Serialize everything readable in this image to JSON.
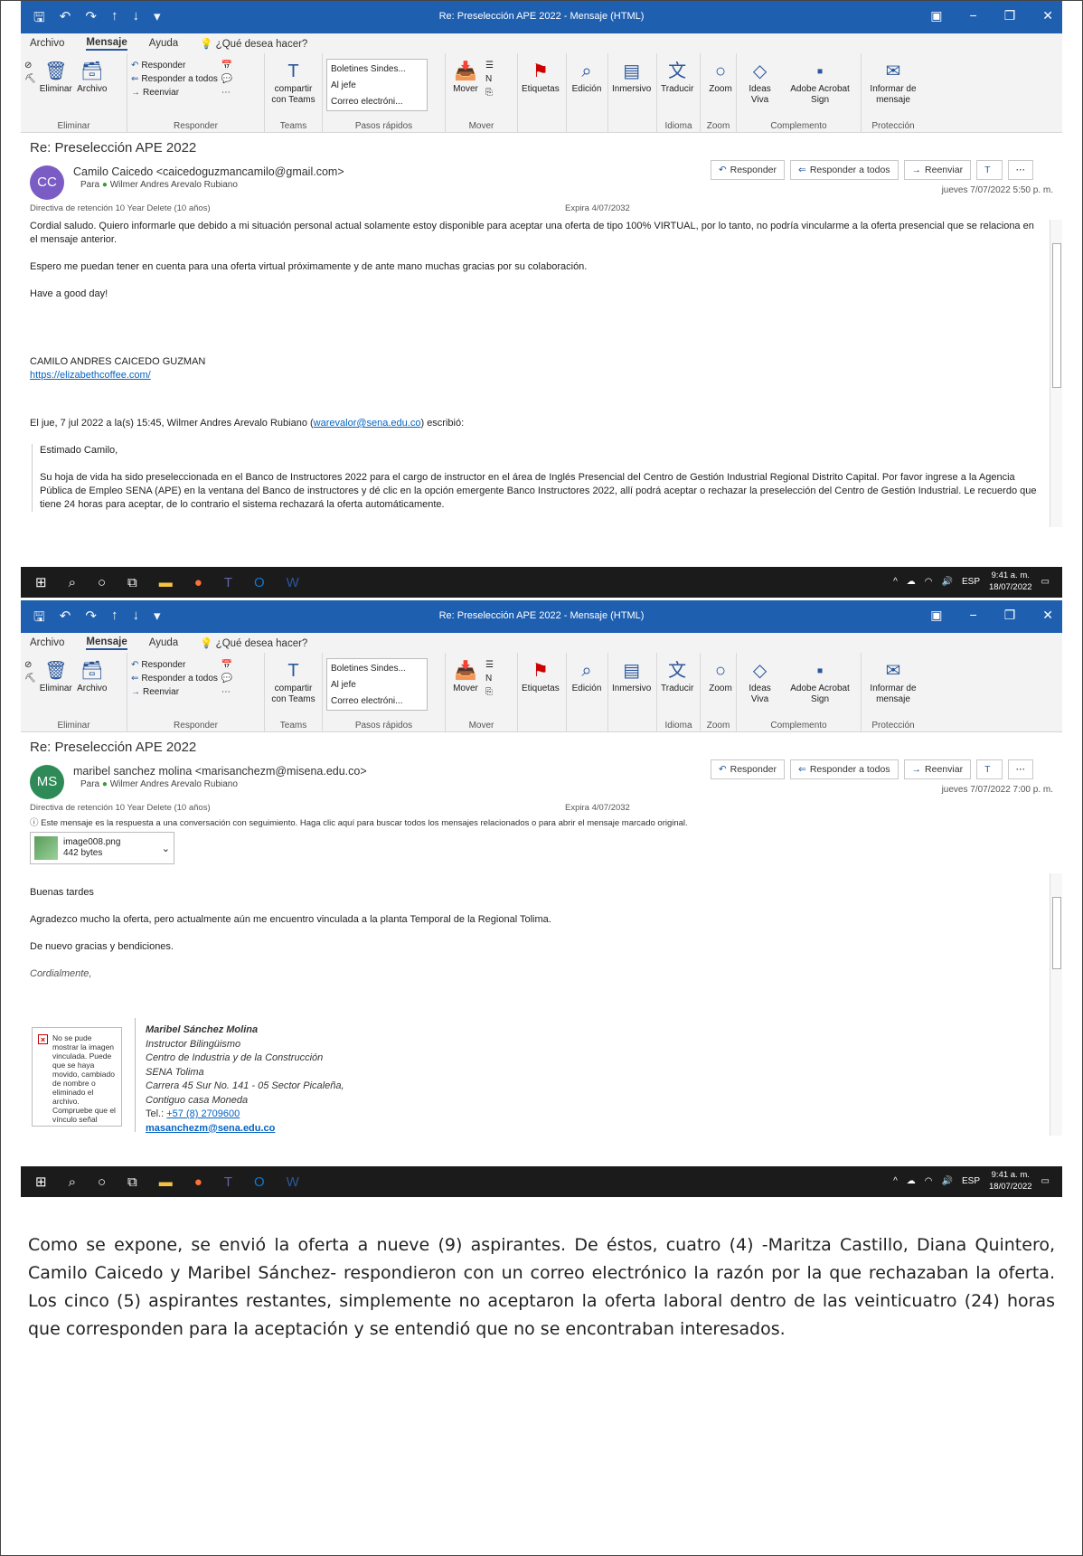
{
  "window": {
    "title": "Re: Preselección APE 2022  -  Mensaje (HTML)"
  },
  "menu": {
    "items": [
      "Archivo",
      "Mensaje",
      "Ayuda",
      "¿Qué desea hacer?"
    ]
  },
  "ribbon": {
    "eliminar": {
      "delete": "Eliminar",
      "archive": "Archivo",
      "label": "Eliminar"
    },
    "responder": {
      "reply": "Responder",
      "reply_all": "Responder a todos",
      "forward": "Reenviar",
      "label": "Responder"
    },
    "teams": {
      "share": "compartir con Teams",
      "label": "Teams"
    },
    "quick": {
      "items": [
        "Boletines Sindes...",
        "Al jefe",
        "Correo electróni..."
      ],
      "label": "Pasos rápidos"
    },
    "mover": {
      "move": "Mover",
      "label": "Mover"
    },
    "etiquetas": "Etiquetas",
    "edicion": "Edición",
    "inmersivo": "Inmersivo",
    "idioma": {
      "translate": "Traducir",
      "label": "Idioma"
    },
    "zoom": {
      "zoom": "Zoom",
      "label": "Zoom"
    },
    "complemento": {
      "ideas": "Ideas Viva",
      "acrobat": "Adobe Acrobat Sign",
      "label": "Complemento"
    },
    "proteccion": {
      "report": "Informar de mensaje",
      "label": "Protección"
    }
  },
  "actions": {
    "reply": "Responder",
    "reply_all": "Responder a todos",
    "forward": "Reenviar"
  },
  "taskbar": {
    "lang": "ESP",
    "time": "9:41 a. m.",
    "date": "18/07/2022"
  },
  "email1": {
    "subject": "Re: Preselección APE 2022",
    "initials": "CC",
    "avatar_color": "#7b5cc4",
    "from": "Camilo Caicedo <caicedoguzmancamilo@gmail.com>",
    "to": "Wilmer Andres Arevalo Rubiano",
    "retention": "Directiva de retención  10 Year Delete (10 años)",
    "expira": "Expira  4/07/2032",
    "date": "jueves 7/07/2022 5:50 p. m.",
    "body": [
      "Cordial saludo. Quiero informarle que debido a mi situación personal actual solamente estoy disponible para aceptar una oferta de tipo 100% VIRTUAL, por lo tanto, no podría vincularme a la oferta presencial que se relaciona en el mensaje anterior.",
      "Espero me puedan tener en cuenta para una oferta virtual próximamente y de ante mano muchas gracias por su colaboración.",
      "Have a good day!"
    ],
    "signature_name": "CAMILO ANDRES CAICEDO GUZMAN",
    "signature_link": "https://elizabethcoffee.com/",
    "quote_header_pre": "El jue, 7 jul 2022 a la(s) 15:45, Wilmer Andres Arevalo Rubiano (",
    "quote_email": "warevalor@sena.edu.co",
    "quote_header_post": ") escribió:",
    "quote_greeting": "Estimado Camilo,",
    "quote_body": "Su hoja de vida ha sido preseleccionada en el Banco de Instructores 2022 para el cargo de instructor en el área de Inglés Presencial del  Centro de Gestión Industrial Regional Distrito Capital. Por favor ingrese a la Agencia Pública de Empleo SENA (APE) en la ventana del Banco de instructores y dé clic en la opción emergente Banco Instructores 2022, allí podrá aceptar o rechazar la preselección del Centro de Gestión Industrial. Le recuerdo que tiene 24 horas para aceptar, de lo contrario el sistema rechazará la oferta automáticamente."
  },
  "email2": {
    "subject": "Re: Preselección APE 2022",
    "initials": "MS",
    "avatar_color": "#2e8b57",
    "from": "maribel sanchez molina <marisanchezm@misena.edu.co>",
    "to": "Wilmer Andres Arevalo Rubiano",
    "retention": "Directiva de retención  10 Year Delete (10 años)",
    "expira": "Expira  4/07/2032",
    "date": "jueves 7/07/2022 7:00 p. m.",
    "info": "Este mensaje es la respuesta a una conversación con seguimiento. Haga clic aquí para buscar todos los mensajes relacionados o para abrir el mensaje marcado original.",
    "attachment": {
      "name": "image008.png",
      "size": "442 bytes"
    },
    "body": [
      "Buenas tardes",
      "Agradezco mucho la oferta, pero actualmente aún me encuentro vinculada a la planta Temporal de la Regional Tolima.",
      "De nuevo gracias y bendiciones."
    ],
    "closing": "Cordialmente,",
    "broken_image": "No se pude mostrar la imagen vinculada. Puede que se haya movido, cambiado de nombre o eliminado el archivo. Compruebe que el vínculo señal",
    "signature": {
      "name": "Maribel Sánchez Molina",
      "title": "Instructor Bilingüismo",
      "center": "Centro de Industria y de la Construcción",
      "org": "SENA Tolima",
      "address": "Carrera 45 Sur No. 141 - 05 Sector Picaleña,",
      "address2": "Contiguo  casa Moneda",
      "tel_label": "Tel.: ",
      "tel": "+57 (8) 2709600",
      "email": "masanchezm@sena.edu.co"
    }
  },
  "document": {
    "paragraph": "Como se expone, se envió la oferta a nueve (9) aspirantes. De éstos, cuatro (4) -Maritza Castillo, Diana Quintero, Camilo Caicedo y Maribel Sánchez- respondieron con un correo electrónico la razón por la que rechazaban la oferta. Los cinco (5) aspirantes restantes, simplemente no aceptaron la oferta laboral dentro de las veinticuatro (24) horas que corresponden para la aceptación y se entendió que no se encontraban interesados."
  }
}
